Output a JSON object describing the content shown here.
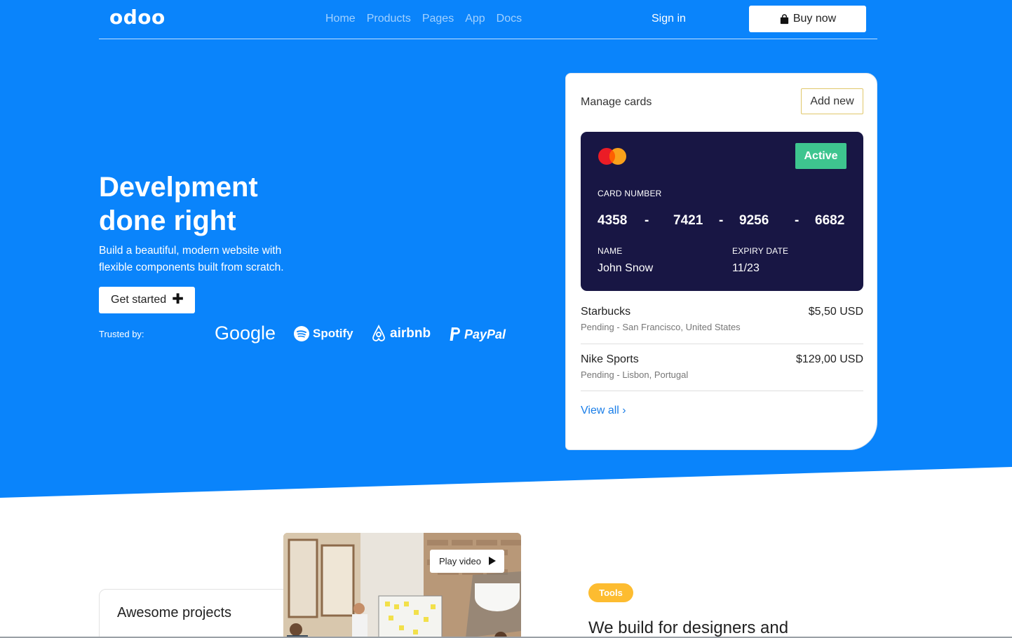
{
  "navbar": {
    "logo": "odoo",
    "links": [
      "Home",
      "Products",
      "Pages",
      "App",
      "Docs"
    ],
    "signin_label": "Sign in",
    "buy_label": "Buy now"
  },
  "hero": {
    "title_line1": "Develpment",
    "title_line2": "done right",
    "subtitle": "Build a beautiful, modern website with flexible components built from scratch.",
    "cta_label": "Get started",
    "trusted_label": "Trusted by:",
    "brands": [
      "Google",
      "Spotify",
      "airbnb",
      "PayPal"
    ]
  },
  "cards_panel": {
    "title": "Manage cards",
    "add_label": "Add new",
    "card": {
      "status": "Active",
      "number_label": "CARD NUMBER",
      "number_groups": [
        "4358",
        "7421",
        "9256",
        "6682"
      ],
      "separator": "-",
      "name_label": "NAME",
      "name_value": "John Snow",
      "expiry_label": "EXPIRY DATE",
      "expiry_value": "11/23"
    },
    "transactions": [
      {
        "merchant": "Starbucks",
        "amount": "$5,50 USD",
        "status": "Pending",
        "location": "San Francisco, United States"
      },
      {
        "merchant": "Nike Sports",
        "amount": "$129,00 USD",
        "status": "Pending",
        "location": "Lisbon, Portugal"
      }
    ],
    "meta_separator": "-",
    "view_all_label": "View all"
  },
  "lower": {
    "projects_title": "Awesome projects",
    "play_label": "Play video",
    "tools_badge": "Tools",
    "heading": "We build for designers and"
  },
  "colors": {
    "hero_blue": "#0a84fb",
    "card_navy": "#181644",
    "active_green": "#3ec58f",
    "tools_yellow": "#fdbc30",
    "link_blue": "#1a7ee8"
  }
}
